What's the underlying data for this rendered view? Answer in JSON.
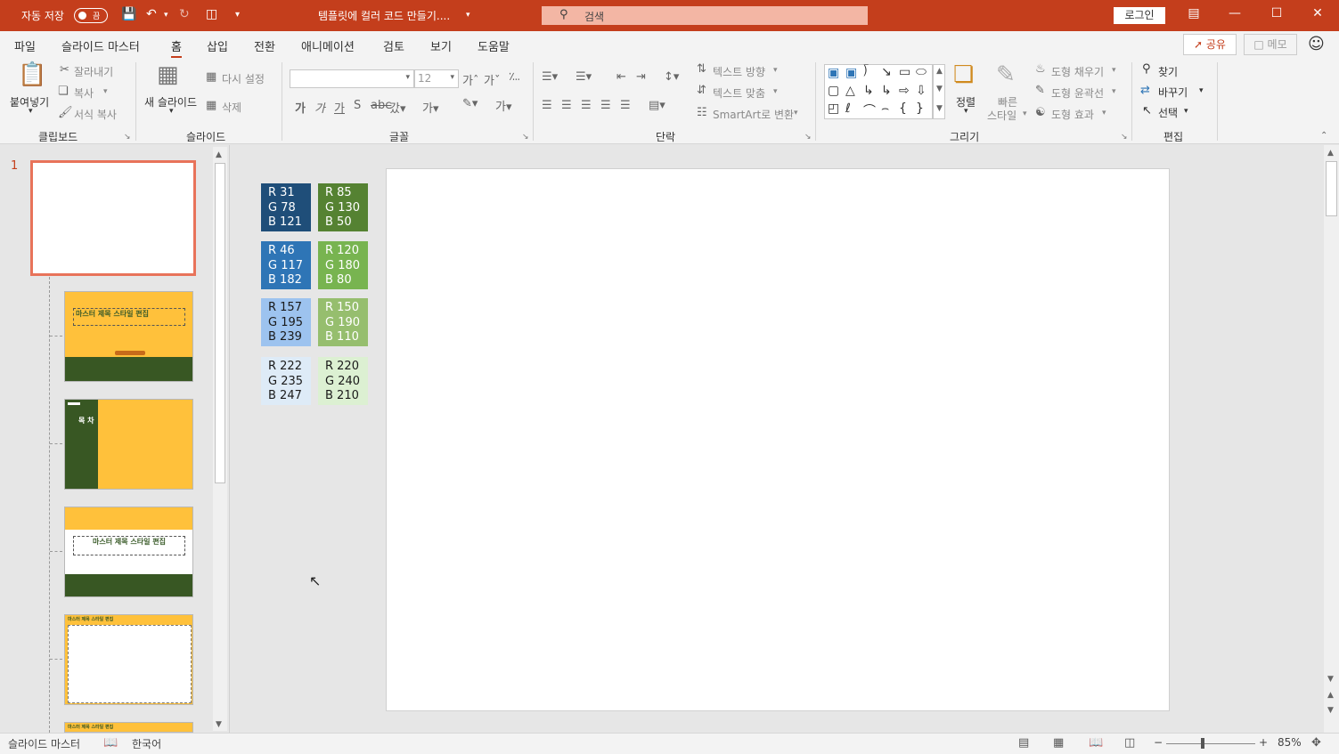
{
  "titlebar": {
    "autosave_label": "자동 저장",
    "autosave_state": "끔",
    "doc_title": "템플릿에 컬러 코드 만들기....",
    "search_placeholder": "검색",
    "login_label": "로그인"
  },
  "tabs": [
    "파일",
    "슬라이드 마스터",
    "홈",
    "삽입",
    "전환",
    "애니메이션",
    "검토",
    "보기",
    "도움말"
  ],
  "active_tab": "홈",
  "header_right": {
    "share": "공유",
    "memo": "메모"
  },
  "ribbon": {
    "clipboard": {
      "paste": "붙여넣기",
      "cut": "잘라내기",
      "copy": "복사",
      "format_painter": "서식 복사",
      "group": "클립보드"
    },
    "slides": {
      "new_slide_1": "새 슬라이드",
      "reset": "다시 설정",
      "delete": "삭제",
      "group": "슬라이드"
    },
    "font": {
      "size": "12",
      "group": "글꼴"
    },
    "paragraph": {
      "text_direction": "텍스트 방향",
      "align_text": "텍스트 맞춤",
      "smartart": "SmartArt로 변환",
      "group": "단락"
    },
    "drawing": {
      "arrange": "정렬",
      "quick_styles_1": "빠른",
      "quick_styles_2": "스타일",
      "shape_fill": "도형 채우기",
      "shape_outline": "도형 윤곽선",
      "shape_effects": "도형 효과",
      "group": "그리기"
    },
    "editing": {
      "find": "찾기",
      "replace": "바꾸기",
      "select": "선택",
      "group": "편집"
    }
  },
  "thumbnails": {
    "slide_number": "1",
    "master_title_text": "마스터 제목 스타일 편집",
    "toc_text": "목 차"
  },
  "swatches": [
    {
      "text": "R 31\nG 78\nB 121",
      "bg": "#1f4e79",
      "fg": "#ffffff"
    },
    {
      "text": "R 85\nG 130\nB 50",
      "bg": "#558232",
      "fg": "#ffffff"
    },
    {
      "text": "R 46\nG 117\nB 182",
      "bg": "#2e75b6",
      "fg": "#ffffff"
    },
    {
      "text": "R 120\nG 180\nB 80",
      "bg": "#78b450",
      "fg": "#ffffff"
    },
    {
      "text": "R 157\nG 195\nB 239",
      "bg": "#9dc3ef",
      "fg": "#1a1a1a"
    },
    {
      "text": "R 150\nG 190\nB 110",
      "bg": "#96be6e",
      "fg": "#ffffff"
    },
    {
      "text": "R 222\nG 235\nB 247",
      "bg": "#deebf7",
      "fg": "#1a1a1a"
    },
    {
      "text": "R 220\nG 240\nB 210",
      "bg": "#dcf0d2",
      "fg": "#1a1a1a"
    }
  ],
  "statusbar": {
    "view": "슬라이드 마스터",
    "language": "한국어",
    "zoom": "85%"
  },
  "colors": {
    "accent": "#c43e1c",
    "dark_green": "#385723",
    "yellow": "#ffc13b"
  }
}
